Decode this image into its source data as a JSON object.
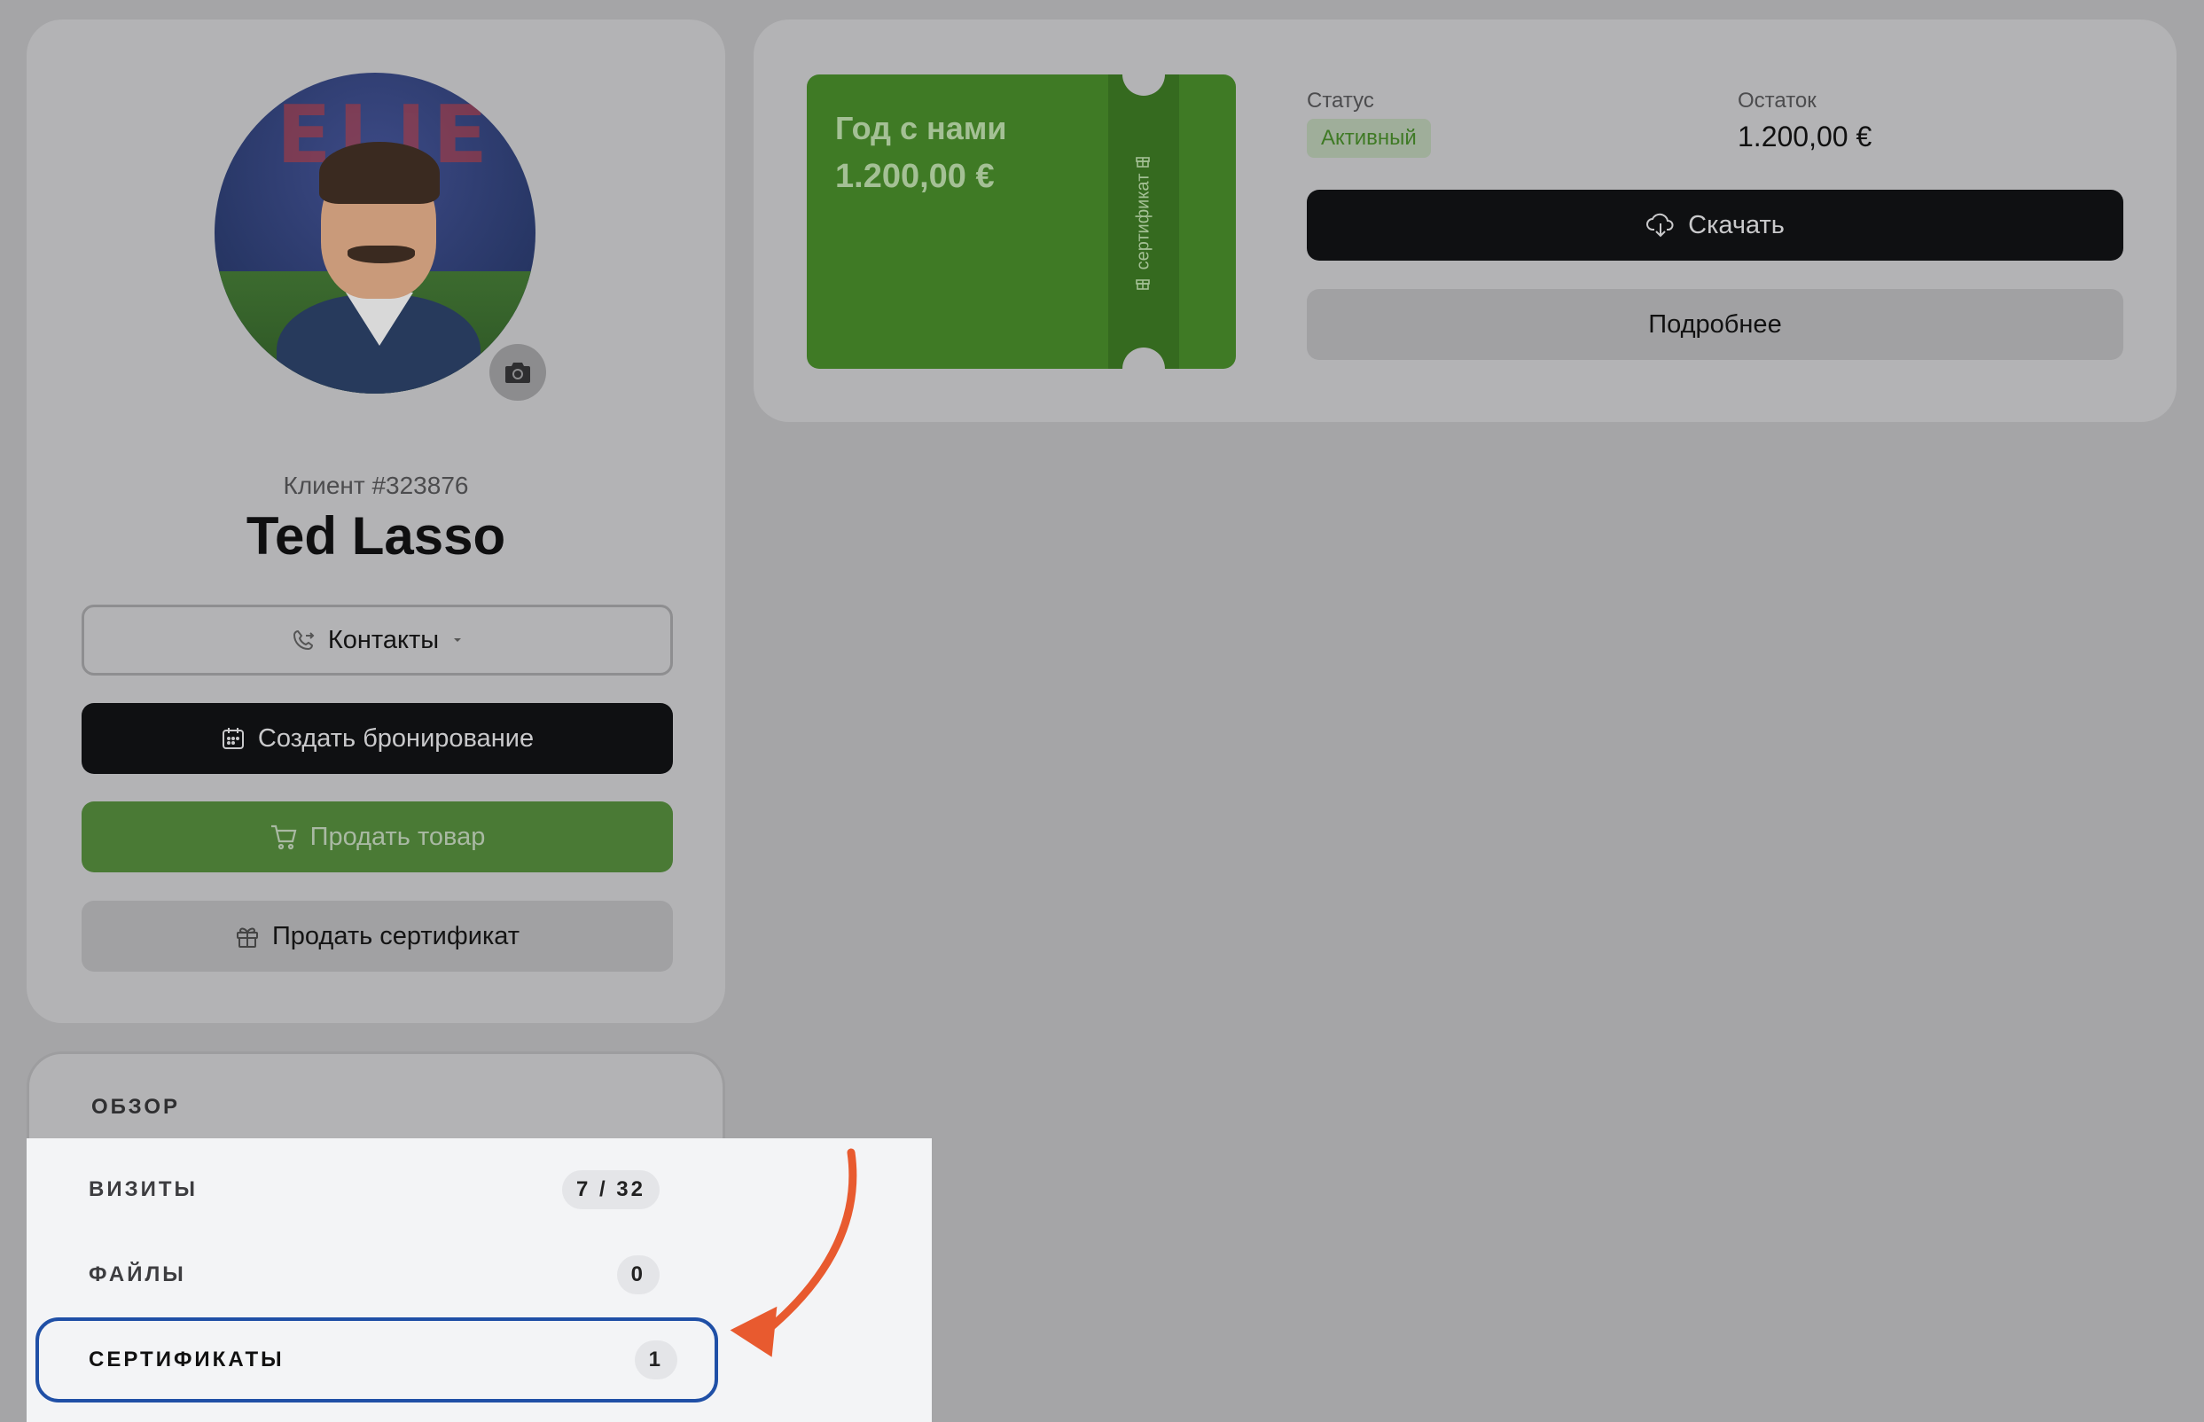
{
  "client": {
    "id_label": "Клиент #323876",
    "name": "Ted Lasso",
    "avatar_banner_text": "ELIE"
  },
  "actions": {
    "contacts_label": "Контакты",
    "create_booking_label": "Создать бронирование",
    "sell_product_label": "Продать товар",
    "sell_certificate_label": "Продать сертификат"
  },
  "nav": {
    "heading": "ОБЗОР",
    "items": [
      {
        "label": "ВИЗИТЫ",
        "count": "7 / 32"
      },
      {
        "label": "ФАЙЛЫ",
        "count": "0"
      },
      {
        "label": "СЕРТИФИКАТЫ",
        "count": "1",
        "active": true
      }
    ]
  },
  "certificate": {
    "title": "Год с нами",
    "amount": "1.200,00 €",
    "vertical_label": "сертификат",
    "status_label": "Статус",
    "status_value": "Активный",
    "balance_label": "Остаток",
    "balance_value": "1.200,00 €",
    "download_label": "Скачать",
    "details_label": "Подробнее"
  },
  "icons": {
    "camera": "camera-icon",
    "contacts": "phone-arrow-icon",
    "dropdown": "caret-down-icon",
    "booking": "calendar-icon",
    "cart": "cart-icon",
    "gift": "gift-icon",
    "download": "cloud-download-icon"
  },
  "colors": {
    "accent_green": "#3f7a25",
    "dark_button": "#0f1012",
    "active_outline": "#1f4fa6",
    "annotation_arrow": "#e85a2f"
  }
}
